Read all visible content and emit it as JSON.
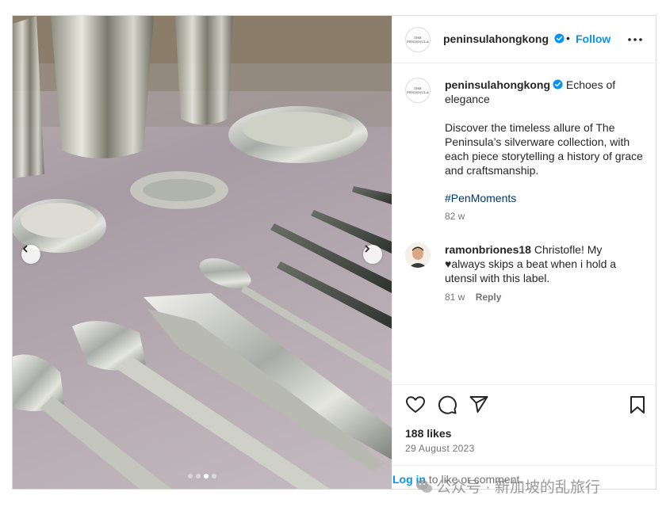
{
  "post": {
    "username": "peninsulahongkong",
    "separator": "•",
    "follow_label": "Follow",
    "avatar_logo_text": "THE PENINSULA",
    "caption_title": "Echoes of elegance",
    "caption_body": "Discover the timeless allure of The Peninsula’s silverware collection, with each piece storytelling a history of grace and craftsmanship.",
    "hashtag": "#PenMoments",
    "caption_time": "82 w",
    "comment": {
      "username": "ramonbriones18",
      "text_before": "Christofle! My",
      "heart": "♥",
      "text_after": "always skips a beat when i hold a utensil with this label.",
      "time": "81 w",
      "reply_label": "Reply"
    },
    "likes": "188 likes",
    "date": "29 August 2023",
    "login_link": "Log in",
    "login_text": "to like or comment."
  },
  "carousel": {
    "total": 4,
    "active_index": 2
  },
  "watermark": {
    "text": "公众号 · 新加坡的乱旅行"
  },
  "icons": [
    "more-options-icon",
    "verified-badge-icon",
    "chevron-left-icon",
    "chevron-right-icon",
    "heart-icon",
    "comment-icon",
    "share-icon",
    "bookmark-icon"
  ],
  "colors": {
    "accent": "#0095f6",
    "hashtag": "#00376b",
    "verified": "#0095f6",
    "muted": "#737373"
  }
}
